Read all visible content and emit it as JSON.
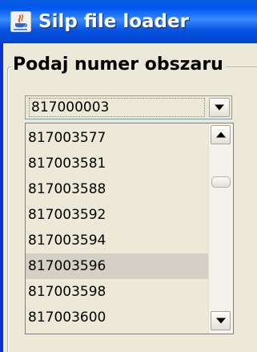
{
  "window": {
    "title": "Silp file loader",
    "icon": "java-icon"
  },
  "group": {
    "title": "Podaj numer obszaru"
  },
  "combo": {
    "selected_value": "817000003"
  },
  "list": {
    "items": [
      "817003577",
      "817003581",
      "817003588",
      "817003592",
      "817003594",
      "817003596",
      "817003598",
      "817003600"
    ],
    "selected_item": "817003596"
  },
  "colors": {
    "titlebar": "#0058ee",
    "window_bg": "#ece9d8",
    "selection": "#d4d0c6"
  }
}
